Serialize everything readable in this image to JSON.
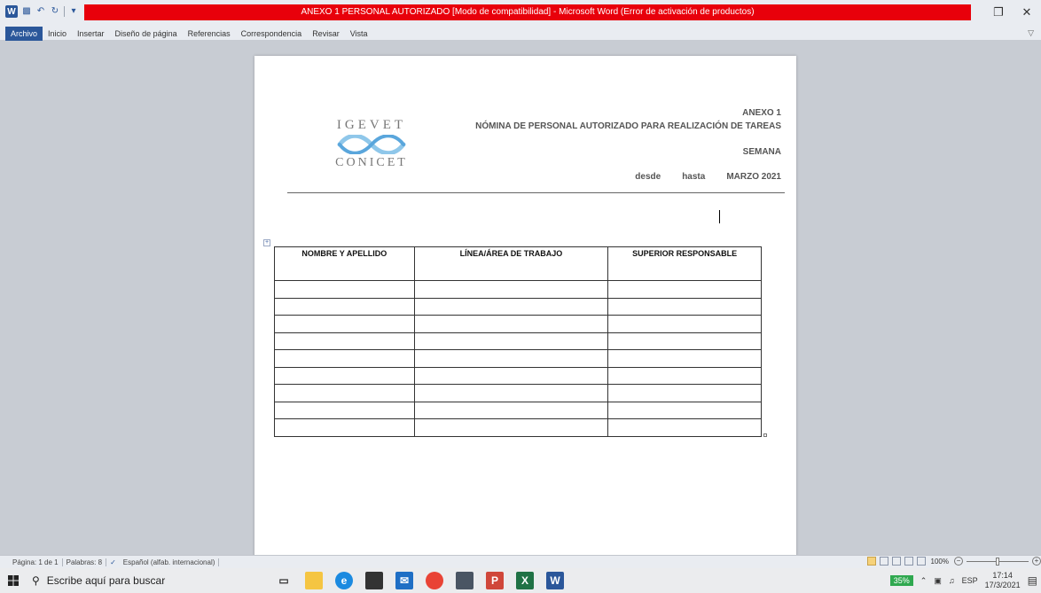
{
  "window": {
    "title": "ANEXO 1 PERSONAL AUTORIZADO [Modo de compatibilidad] - Microsoft Word (Error de activación de productos)",
    "accent": "#e8000b"
  },
  "ribbon": {
    "tabs": [
      "Archivo",
      "Inicio",
      "Insertar",
      "Diseño de página",
      "Referencias",
      "Correspondencia",
      "Revisar",
      "Vista"
    ],
    "active_tab": "Archivo"
  },
  "document": {
    "logo": {
      "line1": "IGEVET",
      "line2": "CONICET"
    },
    "header": {
      "anexo": "ANEXO 1",
      "nomina": "NÓMINA DE PERSONAL AUTORIZADO PARA REALIZACIÓN DE TAREAS",
      "semana": "SEMANA",
      "desde": "desde",
      "hasta": "hasta",
      "periodo": "MARZO 2021"
    },
    "table": {
      "columns": [
        "NOMBRE Y APELLIDO",
        "LÍNEA/ÁREA DE TRABAJO",
        "SUPERIOR RESPONSABLE"
      ],
      "empty_rows": 9
    }
  },
  "statusbar": {
    "page": "Página: 1 de 1",
    "words": "Palabras: 8",
    "language": "Español (alfab. internacional)",
    "zoom": "100%"
  },
  "taskbar": {
    "search_placeholder": "Escribe aquí para buscar",
    "battery": "35%",
    "language": "ESP",
    "time": "17:14",
    "date": "17/3/2021"
  }
}
